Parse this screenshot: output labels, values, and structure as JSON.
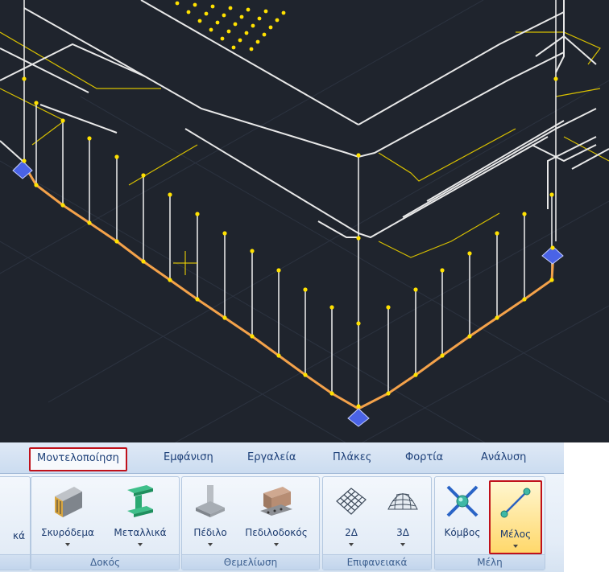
{
  "tabs": [
    "Μοντελοποίηση",
    "Εμφάνιση",
    "Εργαλεία",
    "Πλάκες",
    "Φορτία",
    "Ανάλυση"
  ],
  "partial_label": "κά",
  "groups": {
    "beam": {
      "label": "Δοκός",
      "buttons": [
        "Σκυρόδεμα",
        "Μεταλλικά"
      ]
    },
    "foundation": {
      "label": "Θεμελίωση",
      "buttons": [
        "Πέδιλο",
        "Πεδιλοδοκός"
      ]
    },
    "surfaces": {
      "label": "Επιφανειακά",
      "buttons": [
        "2Δ",
        "3Δ"
      ]
    },
    "members": {
      "label": "Μέλη",
      "buttons": [
        "Κόμβος",
        "Μέλος"
      ]
    }
  },
  "colors": {
    "viewport_bg": "#1f242d",
    "beam_orange": "#f4a24a",
    "node_yellow": "#ffe100",
    "support_blue": "#4a63e6",
    "highlight_red": "#c0111b"
  },
  "icons": [
    "concrete-beam-icon",
    "steel-beam-icon",
    "footing-icon",
    "strip-footing-icon",
    "grid-2d-icon",
    "dome-3d-icon",
    "node-icon",
    "member-icon"
  ]
}
